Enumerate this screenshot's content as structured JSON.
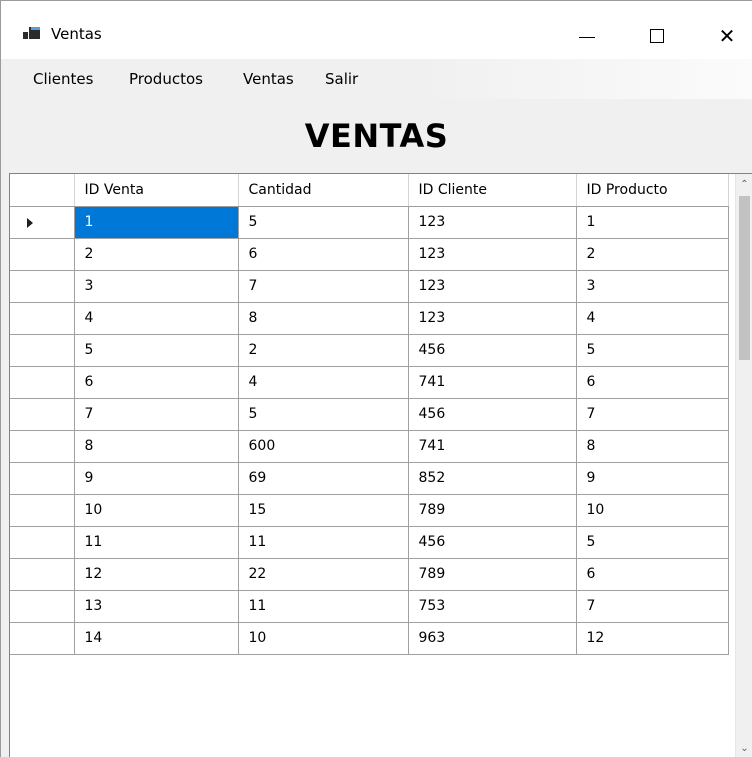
{
  "window": {
    "title": "Ventas",
    "close_glyph": "✕"
  },
  "menu": {
    "items": [
      "Clientes",
      "Productos",
      "Ventas",
      "Salir"
    ]
  },
  "heading": "VENTAS",
  "grid": {
    "columns": [
      "ID Venta",
      "Cantidad",
      "ID Cliente",
      "ID Producto"
    ],
    "selected_row": 0,
    "rows": [
      [
        "1",
        "5",
        "123",
        "1"
      ],
      [
        "2",
        "6",
        "123",
        "2"
      ],
      [
        "3",
        "7",
        "123",
        "3"
      ],
      [
        "4",
        "8",
        "123",
        "4"
      ],
      [
        "5",
        "2",
        "456",
        "5"
      ],
      [
        "6",
        "4",
        "741",
        "6"
      ],
      [
        "7",
        "5",
        "456",
        "7"
      ],
      [
        "8",
        "600",
        "741",
        "8"
      ],
      [
        "9",
        "69",
        "852",
        "9"
      ],
      [
        "10",
        "15",
        "789",
        "10"
      ],
      [
        "11",
        "11",
        "456",
        "5"
      ],
      [
        "12",
        "22",
        "789",
        "6"
      ],
      [
        "13",
        "11",
        "753",
        "7"
      ],
      [
        "14",
        "10",
        "963",
        "12"
      ]
    ],
    "scrollbar": {
      "up_glyph": "⌃",
      "down_glyph": "⌄"
    }
  },
  "colors": {
    "selection": "#0078d7",
    "window_bg": "#f0f0f0"
  },
  "icons": {
    "app": "window-app-icon",
    "minimize": "minimize-icon",
    "maximize": "maximize-icon",
    "close": "close-icon",
    "current_row": "row-pointer-icon"
  }
}
